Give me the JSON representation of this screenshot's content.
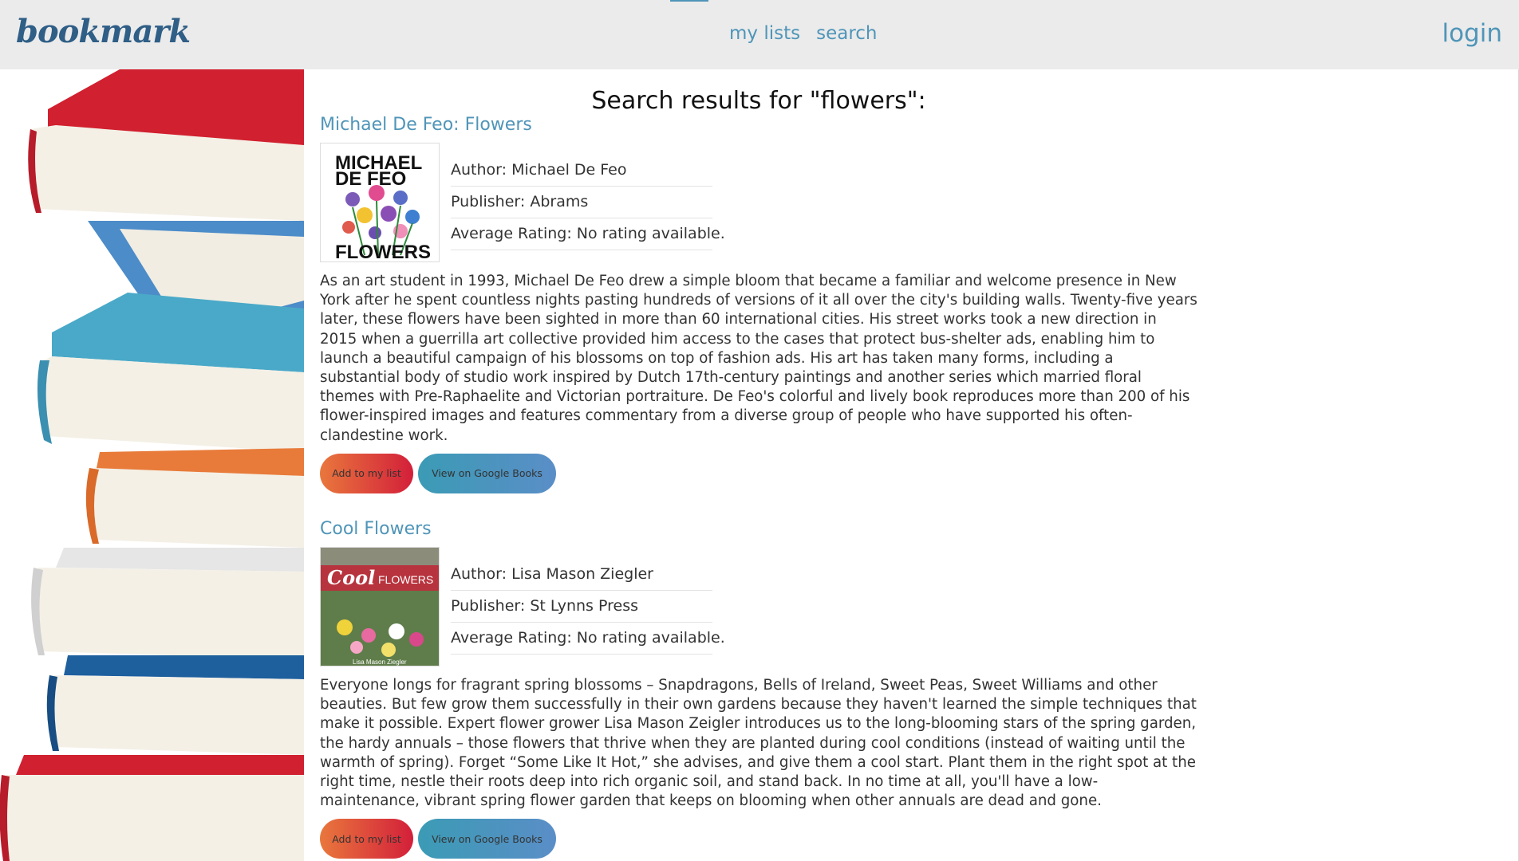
{
  "header": {
    "logo": "bookmark",
    "nav": [
      "my lists",
      "search"
    ],
    "login": "login"
  },
  "results_heading": "Search results for \"flowers\":",
  "books": [
    {
      "title": "Michael De Feo: Flowers",
      "cover_text_top": "MICHAEL DE FEO",
      "cover_text_bottom": "FLOWERS",
      "author": "Author: Michael De Feo",
      "publisher": "Publisher: Abrams",
      "rating": "Average Rating: No rating available.",
      "description": "As an art student in 1993, Michael De Feo drew a simple bloom that became a familiar and welcome presence in New York after he spent countless nights pasting hundreds of versions of it all over the city's building walls. Twenty-five years later, these flowers have been sighted in more than 60 international cities. His street works took a new direction in 2015 when a guerrilla art collective provided him access to the cases that protect bus-shelter ads, enabling him to launch a beautiful campaign of his blossoms on top of fashion ads. His art has taken many forms, including a substantial body of studio work inspired by Dutch 17th-century paintings and another series which married floral themes with Pre-Raphaelite and Victorian portraiture. De Feo's colorful and lively book reproduces more than 200 of his flower-inspired images and features commentary from a diverse group of people who have supported his often-clandestine work.",
      "add_label": "Add to my list",
      "google_label": "View on Google Books"
    },
    {
      "title": "Cool Flowers",
      "cover_text_top": "Cool FLOWERS",
      "cover_text_bottom": "Lisa Mason Ziegler",
      "author": "Author: Lisa Mason Ziegler",
      "publisher": "Publisher: St Lynns Press",
      "rating": "Average Rating: No rating available.",
      "description": "Everyone longs for fragrant spring blossoms – Snapdragons, Bells of Ireland, Sweet Peas, Sweet Williams and other beauties. But few grow them successfully in their own gardens because they haven't learned the simple techniques that make it possible. Expert flower grower Lisa Mason Zeigler introduces us to the long-blooming stars of the spring garden, the hardy annuals – those flowers that thrive when they are planted during cool conditions (instead of waiting until the warmth of spring). Forget “Some Like It Hot,” she advises, and give them a cool start. Plant them in the right spot at the right time, nestle their roots deep into rich organic soil, and stand back. In no time at all, you'll have a low-maintenance, vibrant spring flower garden that keeps on blooming when other annuals are dead and gone.",
      "add_label": "Add to my list",
      "google_label": "View on Google Books"
    }
  ]
}
